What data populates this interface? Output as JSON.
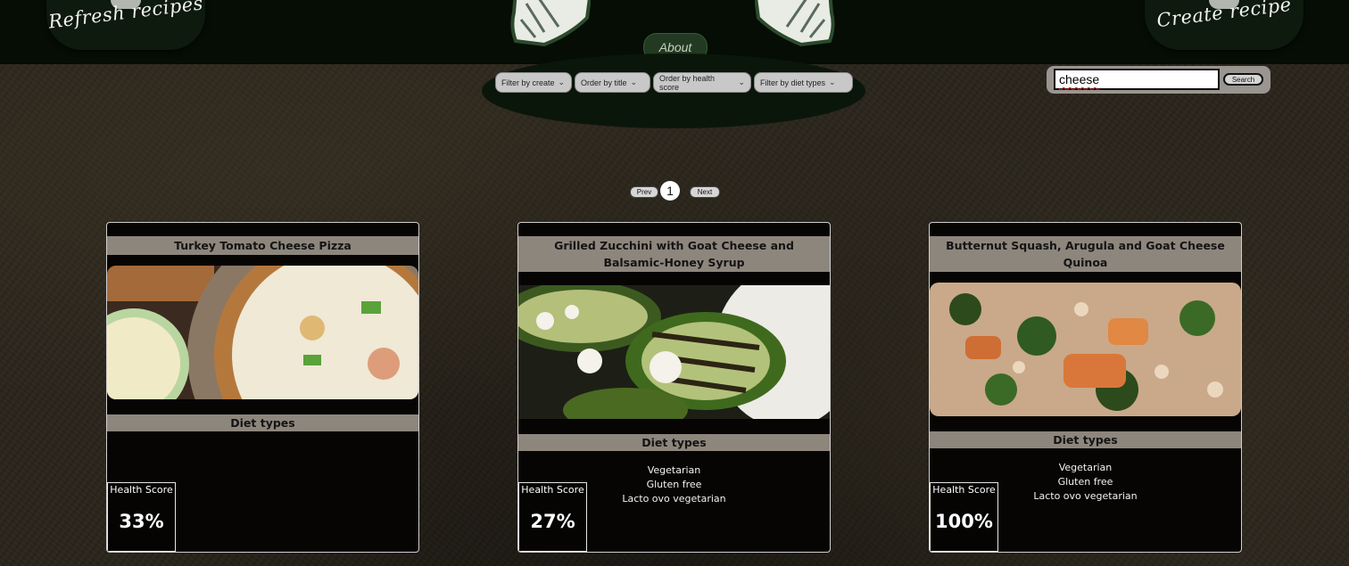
{
  "header": {
    "left_badge_label": "Refresh recipes",
    "right_badge_label": "Create recipe",
    "about_label": "About"
  },
  "filters": {
    "by_create": "Filter by create",
    "by_title": "Order by title",
    "by_health": "Order by health score",
    "by_diet": "Filter by diet types"
  },
  "search": {
    "value": "cheese",
    "button_label": "Search"
  },
  "pagination": {
    "prev_label": "Prev",
    "current_page": "1",
    "next_label": "Next"
  },
  "cards": [
    {
      "title": "Turkey Tomato Cheese Pizza",
      "diet_heading": "Diet types",
      "diets": [],
      "health_label": "Health Score",
      "health_score": "33%"
    },
    {
      "title": "Grilled Zucchini with Goat Cheese and Balsamic-Honey Syrup",
      "diet_heading": "Diet types",
      "diets": [
        "Vegetarian",
        "Gluten free",
        "Lacto ovo vegetarian"
      ],
      "health_label": "Health Score",
      "health_score": "27%"
    },
    {
      "title": "Butternut Squash, Arugula and Goat Cheese Quinoa",
      "diet_heading": "Diet types",
      "diets": [
        "Vegetarian",
        "Gluten free",
        "Lacto ovo vegetarian"
      ],
      "health_label": "Health Score",
      "health_score": "100%"
    }
  ]
}
